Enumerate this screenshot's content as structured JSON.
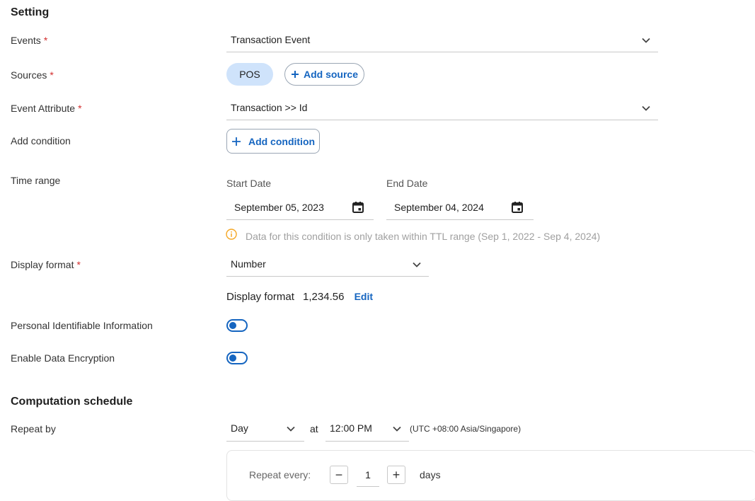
{
  "setting": {
    "title": "Setting",
    "events": {
      "label": "Events",
      "required_mark": "*",
      "value": "Transaction Event"
    },
    "sources": {
      "label": "Sources",
      "required_mark": "*",
      "chips": [
        "POS"
      ],
      "add_label": "Add source"
    },
    "event_attribute": {
      "label": "Event Attribute",
      "required_mark": "*",
      "value": "Transaction >> Id"
    },
    "add_condition": {
      "label": "Add condition",
      "button_label": "Add condition"
    },
    "time_range": {
      "label": "Time range",
      "start_label": "Start Date",
      "start_value": "September 05, 2023",
      "end_label": "End Date",
      "end_value": "September 04, 2024",
      "info": "Data for this condition is only taken within TTL range (Sep 1, 2022 - Sep 4, 2024)"
    },
    "display_format": {
      "label": "Display format",
      "required_mark": "*",
      "value": "Number",
      "preview_label": "Display format",
      "preview_value": "1,234.56",
      "edit_label": "Edit"
    },
    "pii": {
      "label": "Personal Identifiable Information",
      "enabled": false
    },
    "encryption": {
      "label": "Enable Data Encryption",
      "enabled": false
    }
  },
  "schedule": {
    "title": "Computation schedule",
    "repeat_by": {
      "label": "Repeat by",
      "value": "Day",
      "at_label": "at",
      "time_value": "12:00 PM",
      "timezone": "(UTC +08:00 Asia/Singapore)"
    },
    "repeat_every": {
      "label": "Repeat every:",
      "value": "1",
      "unit": "days",
      "minus": "−",
      "plus": "+"
    }
  },
  "colors": {
    "accent": "#1565c0",
    "required": "#d32f2f",
    "chip_bg": "#cfe3fb",
    "info_icon": "#f5a623"
  }
}
